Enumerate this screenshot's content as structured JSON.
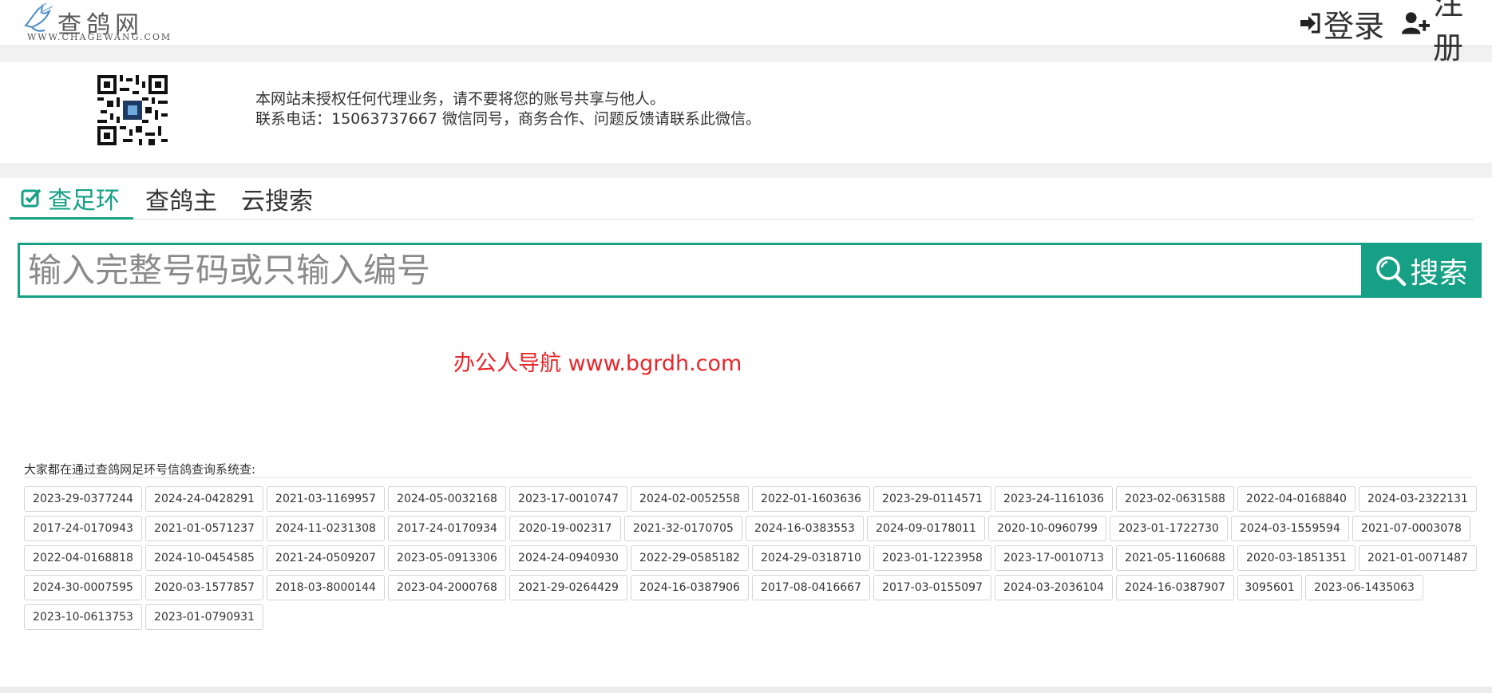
{
  "header": {
    "logo_name": "查鸽网",
    "logo_url": "WWW.CHAGEWANG.COM",
    "login_label": "登录",
    "register_label": "注册"
  },
  "notice": {
    "line1": "本网站未授权任何代理业务，请不要将您的账号共享与他人。",
    "line2": "联系电话：15063737667 微信同号，商务合作、问题反馈请联系此微信。"
  },
  "tabs": [
    {
      "label": "查足环",
      "active": true,
      "icon": "check-square-icon"
    },
    {
      "label": "查鸽主",
      "active": false
    },
    {
      "label": "云搜索",
      "active": false
    }
  ],
  "search": {
    "placeholder": "输入完整号码或只输入编号",
    "button_label": "搜索",
    "icon": "search-icon"
  },
  "ad_text": "办公人导航 www.bgrdh.com",
  "popular": {
    "label": "大家都在通过查鸽网足环号信鸽查询系统查:",
    "tags": [
      [
        "2023-29-0377244",
        "2024-24-0428291",
        "2021-03-1169957",
        "2024-05-0032168",
        "2023-17-0010747",
        "2024-02-0052558",
        "2022-01-1603636",
        "2023-29-0114571",
        "2023-24-1161036",
        "2023-02-0631588",
        "2022-04-0168840",
        "2024-03-2322131"
      ],
      [
        "2017-24-0170943",
        "2021-01-0571237",
        "2024-11-0231308",
        "2017-24-0170934",
        "2020-19-002317",
        "2021-32-0170705",
        "2024-16-0383553",
        "2024-09-0178011",
        "2020-10-0960799",
        "2023-01-1722730",
        "2024-03-1559594",
        "2021-07-0003078"
      ],
      [
        "2022-04-0168818",
        "2024-10-0454585",
        "2021-24-0509207",
        "2023-05-0913306",
        "2024-24-0940930",
        "2022-29-0585182",
        "2024-29-0318710",
        "2023-01-1223958",
        "2023-17-0010713",
        "2021-05-1160688",
        "2020-03-1851351",
        "2021-01-0071487"
      ],
      [
        "2024-30-0007595",
        "2020-03-1577857",
        "2018-03-8000144",
        "2023-04-2000768",
        "2021-29-0264429",
        "2024-16-0387906",
        "2017-08-0416667",
        "2017-03-0155097",
        "2024-03-2036104",
        "2024-16-0387907",
        "3095601",
        "2023-06-1435063"
      ],
      [
        "2023-10-0613753",
        "2023-01-0790931"
      ]
    ]
  },
  "colors": {
    "accent": "#16a085",
    "ad": "#e8262a"
  }
}
